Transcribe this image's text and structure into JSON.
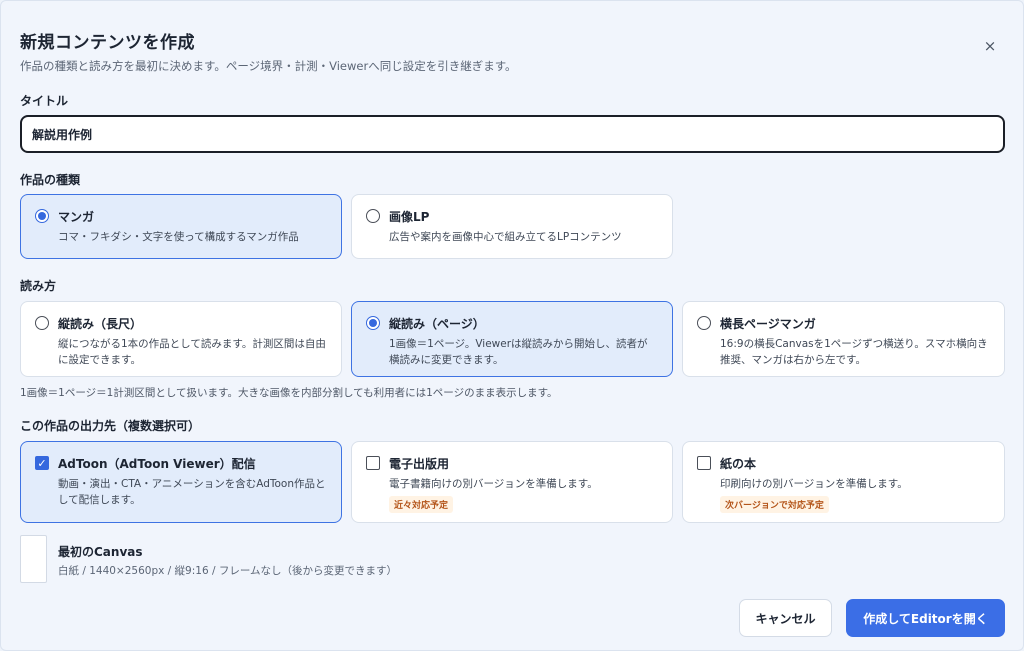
{
  "dialog": {
    "title": "新規コンテンツを作成",
    "subtitle": "作品の種類と読み方を最初に決めます。ページ境界・計測・Viewerへ同じ設定を引き継ぎます。",
    "close_label": "×"
  },
  "title_field": {
    "label": "タイトル",
    "value": "解説用作例"
  },
  "work_type": {
    "label": "作品の種類",
    "options": [
      {
        "title": "マンガ",
        "desc": "コマ・フキダシ・文字を使って構成するマンガ作品",
        "selected": true
      },
      {
        "title": "画像LP",
        "desc": "広告や案内を画像中心で組み立てるLPコンテンツ",
        "selected": false
      }
    ]
  },
  "reading": {
    "label": "読み方",
    "options": [
      {
        "title": "縦読み（長尺）",
        "desc": "縦につながる1本の作品として読みます。計測区間は自由に設定できます。",
        "selected": false
      },
      {
        "title": "縦読み（ページ）",
        "desc": "1画像＝1ページ。Viewerは縦読みから開始し、読者が横読みに変更できます。",
        "selected": true
      },
      {
        "title": "横長ページマンガ",
        "desc": "16:9の横長Canvasを1ページずつ横送り。スマホ横向き推奨、マンガは右から左です。",
        "selected": false
      }
    ],
    "note": "1画像＝1ページ＝1計測区間として扱います。大きな画像を内部分割しても利用者には1ページのまま表示します。"
  },
  "output": {
    "label": "この作品の出力先（複数選択可）",
    "options": [
      {
        "title": "AdToon（AdToon Viewer）配信",
        "desc": "動画・演出・CTA・アニメーションを含むAdToon作品として配信します。",
        "checked": true,
        "badge": ""
      },
      {
        "title": "電子出版用",
        "desc": "電子書籍向けの別バージョンを準備します。",
        "checked": false,
        "badge": "近々対応予定"
      },
      {
        "title": "紙の本",
        "desc": "印刷向けの別バージョンを準備します。",
        "checked": false,
        "badge": "次バージョンで対応予定"
      }
    ]
  },
  "canvas": {
    "title": "最初のCanvas",
    "desc": "白紙 / 1440×2560px / 縦9:16 / フレームなし（後から変更できます）"
  },
  "footer": {
    "cancel_label": "キャンセル",
    "primary_label": "作成してEditorを開く"
  },
  "colors": {
    "accent": "#3b6ee6",
    "selected_bg": "#e2ecfb",
    "badge_text": "#b4551a",
    "badge_bg": "#fff3e4"
  }
}
